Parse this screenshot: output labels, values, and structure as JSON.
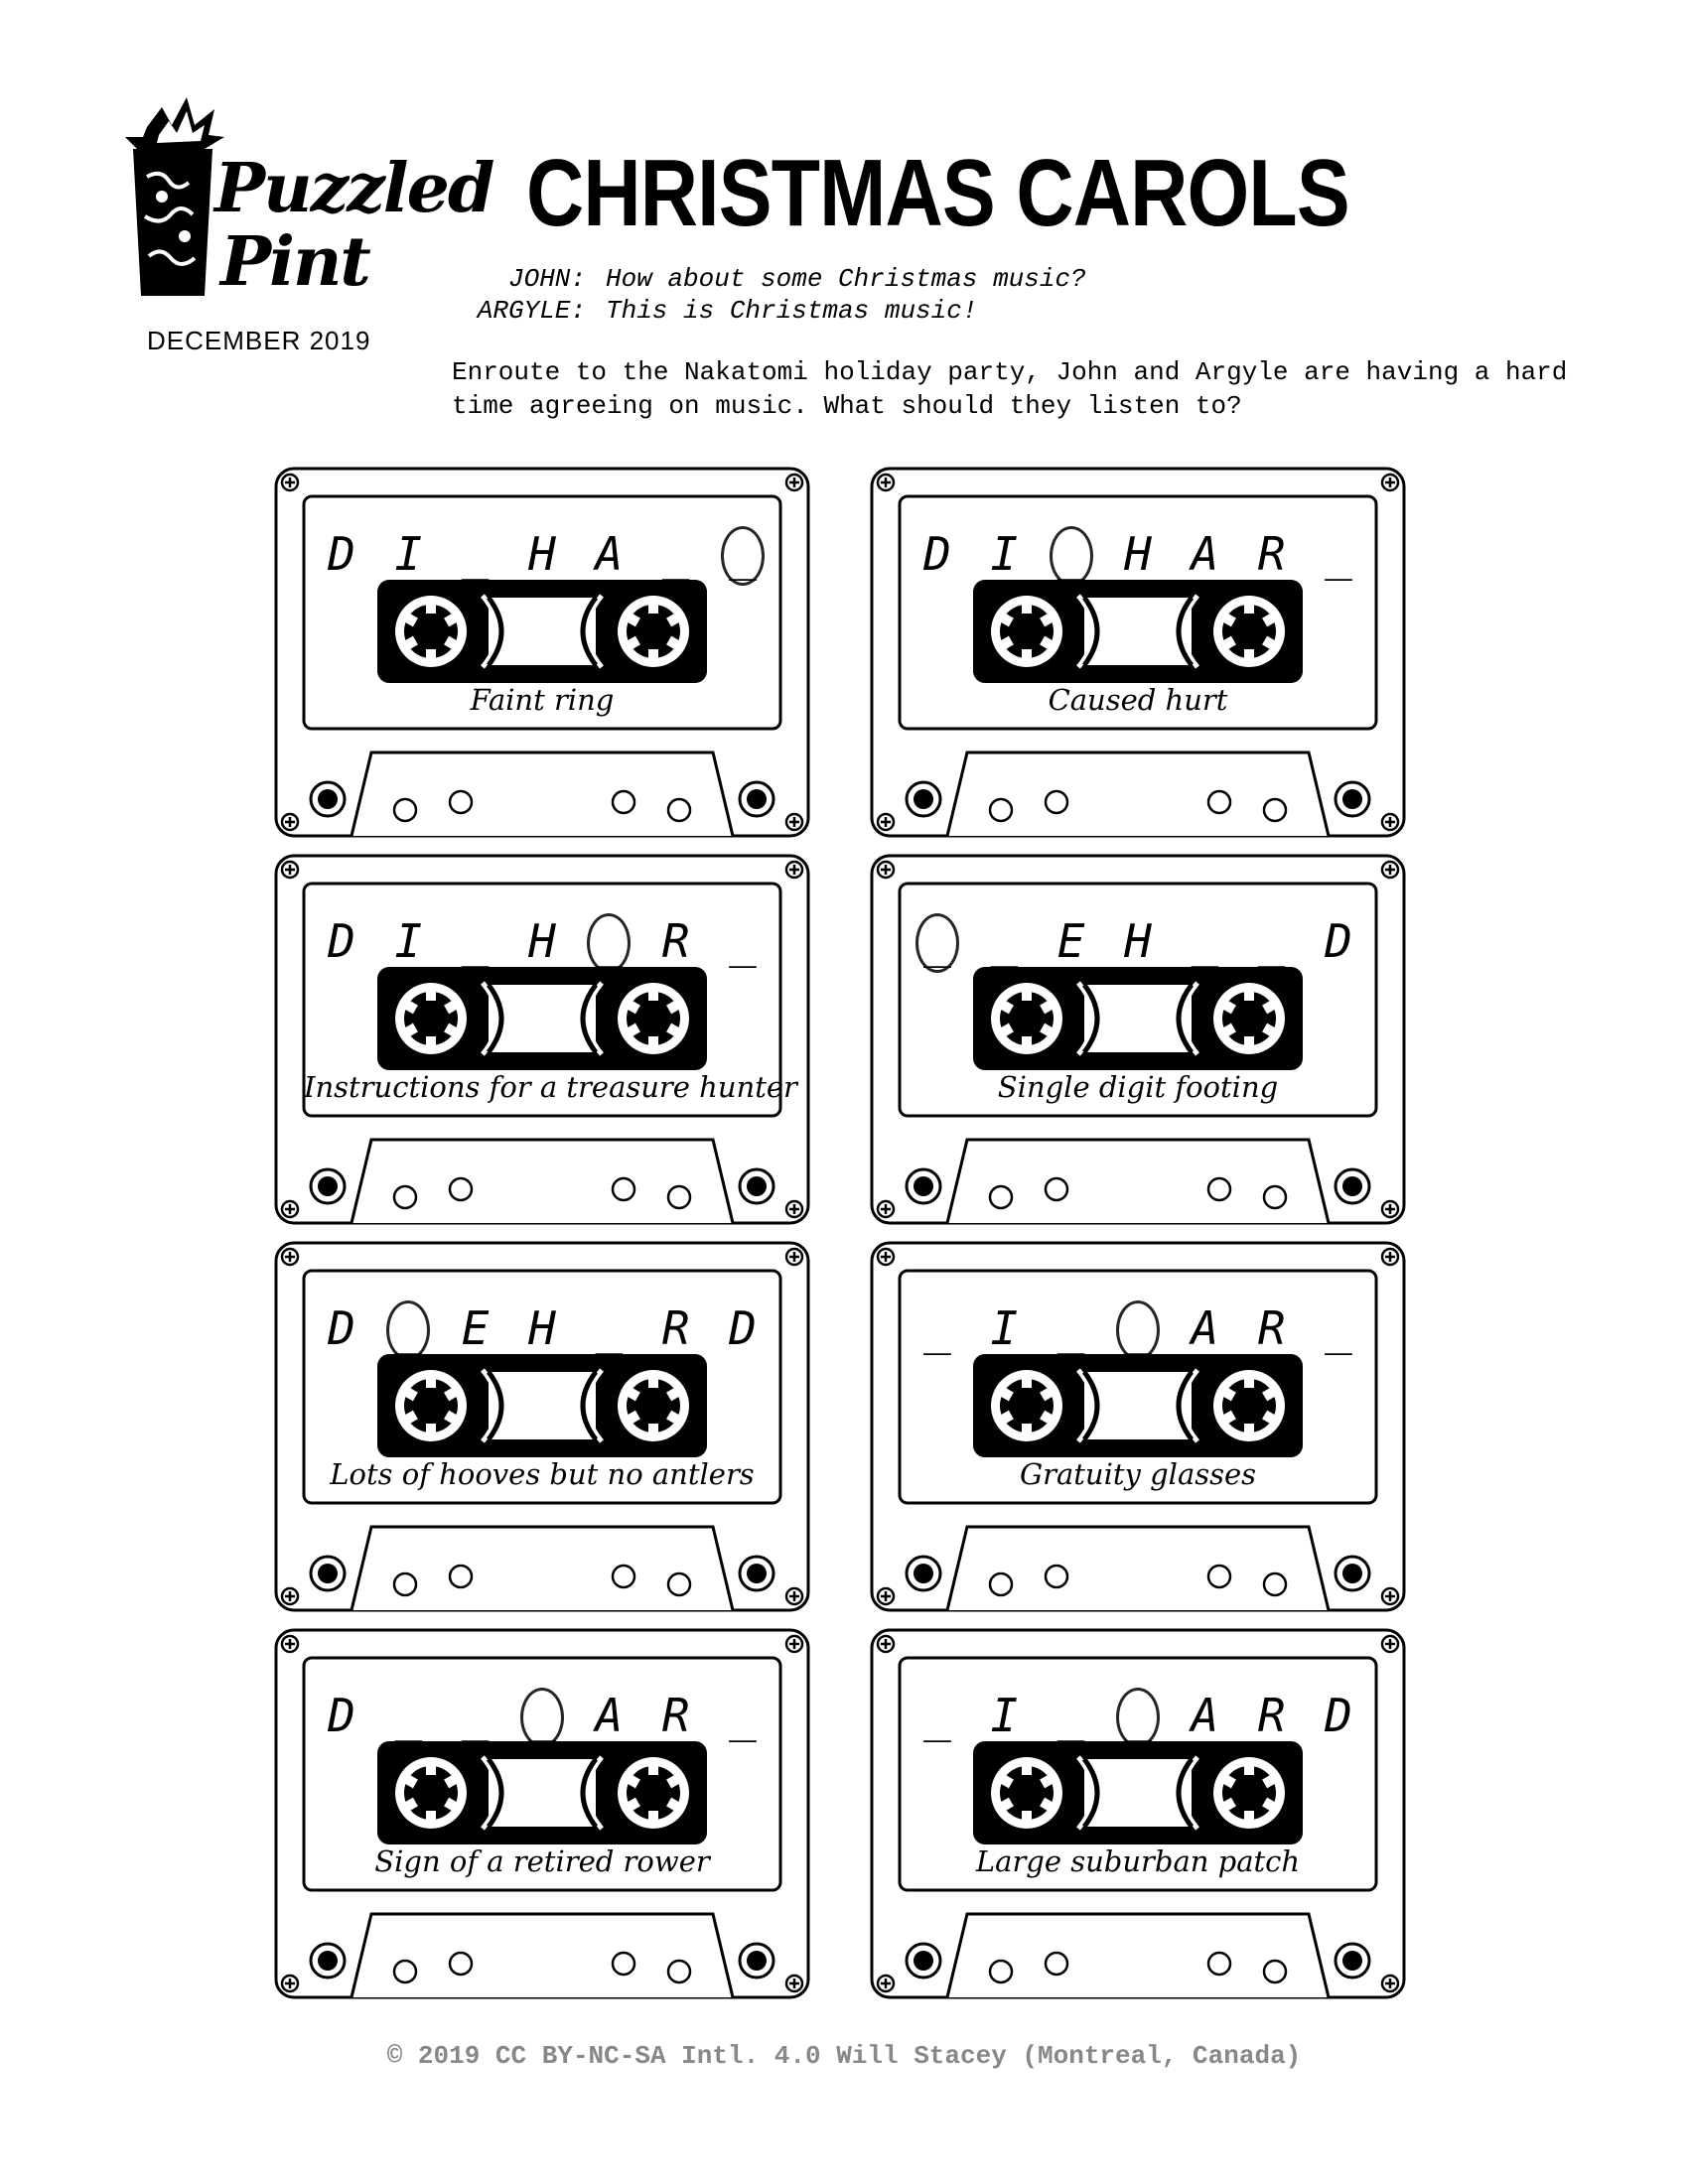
{
  "logo": {
    "word1": "Puzzled",
    "word2": "Pint",
    "month": "DECEMBER 2019"
  },
  "title": "CHRISTMAS CAROLS",
  "dialog": [
    {
      "speaker": "JOHN:",
      "line": "How about some Christmas music?"
    },
    {
      "speaker": "ARGYLE:",
      "line": "This is Christmas music!"
    }
  ],
  "intro": "Enroute to the Nakatomi holiday party, John and Argyle are having a hard time agreeing on music. What should they listen to?",
  "tapes": [
    {
      "letters": [
        "D",
        "I",
        "_",
        "H",
        "A",
        "_",
        "_"
      ],
      "circled": [
        6
      ],
      "clue": "Faint ring"
    },
    {
      "letters": [
        "D",
        "I",
        "_",
        "H",
        "A",
        "R",
        "_"
      ],
      "circled": [
        2
      ],
      "clue": "Caused hurt"
    },
    {
      "letters": [
        "D",
        "I",
        "_",
        "H",
        "_",
        "R",
        "_"
      ],
      "circled": [
        4
      ],
      "clue": "Instructions for a treasure hunter"
    },
    {
      "letters": [
        "_",
        "_",
        "E",
        "H",
        "_",
        "_",
        "D"
      ],
      "circled": [
        0
      ],
      "clue": "Single digit footing"
    },
    {
      "letters": [
        "D",
        "_",
        "E",
        "H",
        "_",
        "R",
        "D"
      ],
      "circled": [
        1
      ],
      "clue": "Lots of hooves but no antlers"
    },
    {
      "letters": [
        "_",
        "I",
        "_",
        "_",
        "A",
        "R",
        "_"
      ],
      "circled": [
        3
      ],
      "clue": "Gratuity glasses"
    },
    {
      "letters": [
        "D",
        "_",
        "_",
        "_",
        "A",
        "R",
        "_"
      ],
      "circled": [
        3
      ],
      "clue": "Sign of a retired rower"
    },
    {
      "letters": [
        "_",
        "I",
        "_",
        "_",
        "A",
        "R",
        "D"
      ],
      "circled": [
        3
      ],
      "clue": "Large suburban patch"
    }
  ],
  "footer": "© 2019 CC BY-NC-SA Intl. 4.0 Will Stacey (Montreal, Canada)"
}
